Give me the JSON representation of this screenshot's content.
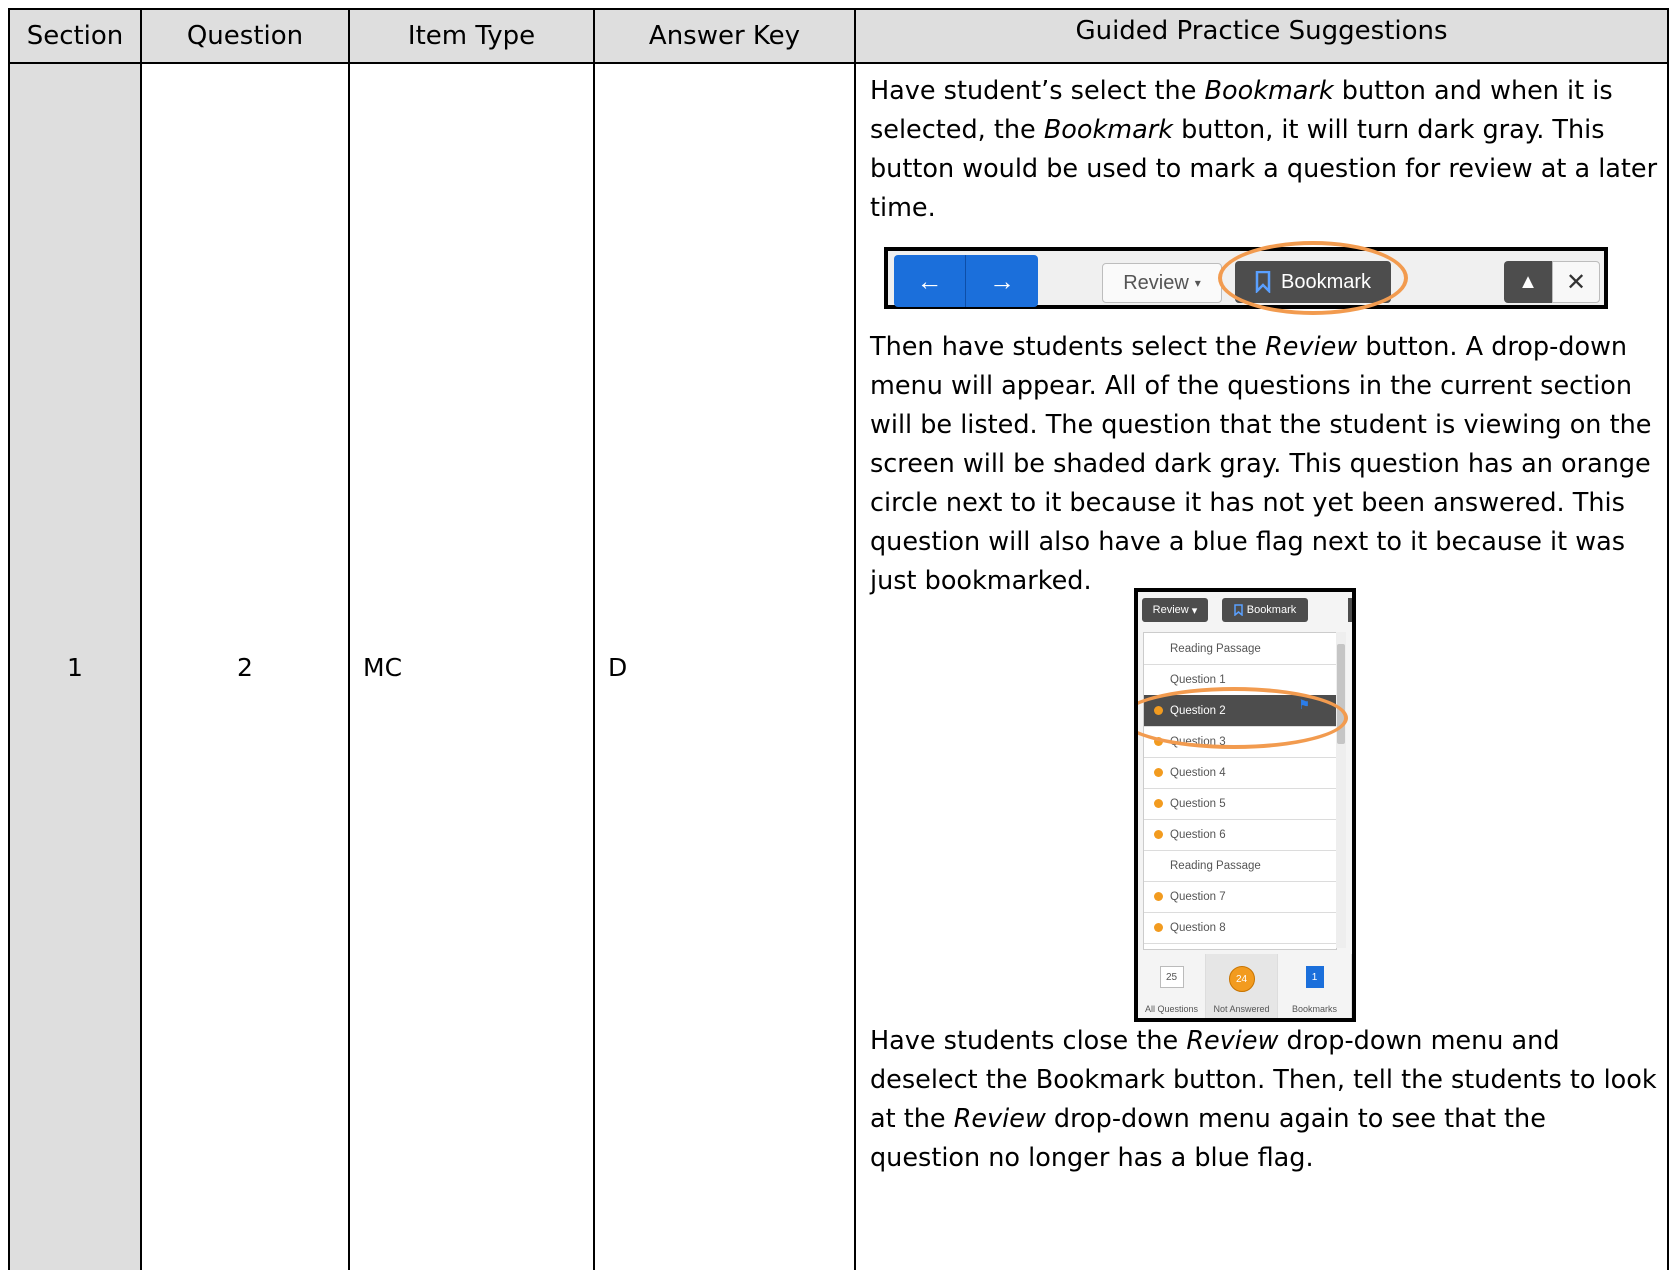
{
  "table": {
    "headers": [
      "Section",
      "Question",
      "Item Type",
      "Answer Key",
      "Guided Practice Suggestions"
    ],
    "row": {
      "section": "1",
      "question": "2",
      "item_type": "MC",
      "answer_key": "D"
    }
  },
  "guidance": {
    "p1": {
      "a": "Have student’s select the ",
      "b": "Bookmark",
      "c": " button and when it is selected, the ",
      "d": "Bookmark",
      "e": " button, it will turn dark gray.  This button would be used to mark a question for review at a later time."
    },
    "p2": {
      "a": "Then have students select the ",
      "b": "Review",
      "c": " button.   A drop-down menu will appear.  All of the questions in the current section will be listed.  The question that the student is viewing on the screen will be shaded dark gray.  This question has an orange circle next to it because it has not yet been answered.  This question will also have a blue flag next to it because it was just bookmarked."
    },
    "p3": {
      "a": "Have students close the ",
      "b": "Review",
      "c": " drop-down menu and deselect the Bookmark button. Then, tell  the students to look at the ",
      "d": "Review",
      "e": " drop-down menu again to see that the question no longer has a blue flag."
    }
  },
  "toolbar_shot": {
    "review_label": "Review",
    "bookmark_label": "Bookmark"
  },
  "menu_shot": {
    "review_label": "Review",
    "bookmark_label": "Bookmark",
    "items": [
      {
        "label": "Reading Passage",
        "dot": false,
        "selected": false
      },
      {
        "label": "Question 1",
        "dot": false,
        "selected": false
      },
      {
        "label": "Question 2",
        "dot": true,
        "selected": true
      },
      {
        "label": "Question 3",
        "dot": true,
        "selected": false
      },
      {
        "label": "Question 4",
        "dot": true,
        "selected": false
      },
      {
        "label": "Question 5",
        "dot": true,
        "selected": false
      },
      {
        "label": "Question 6",
        "dot": true,
        "selected": false
      },
      {
        "label": "Reading Passage",
        "dot": false,
        "selected": false
      },
      {
        "label": "Question 7",
        "dot": true,
        "selected": false
      },
      {
        "label": "Question 8",
        "dot": true,
        "selected": false
      }
    ],
    "footer": {
      "all_count": "25",
      "all_label": "All Questions",
      "not_answered_count": "24",
      "not_answered_label": "Not Answered",
      "bookmarks_count": "1",
      "bookmarks_label": "Bookmarks"
    }
  },
  "colors": {
    "header_bg": "#dedede",
    "highlight_ring": "#f29b4f",
    "nav_blue": "#1b6fdb",
    "dark_button": "#4d4d4d",
    "unanswered_dot": "#f29b1f"
  }
}
